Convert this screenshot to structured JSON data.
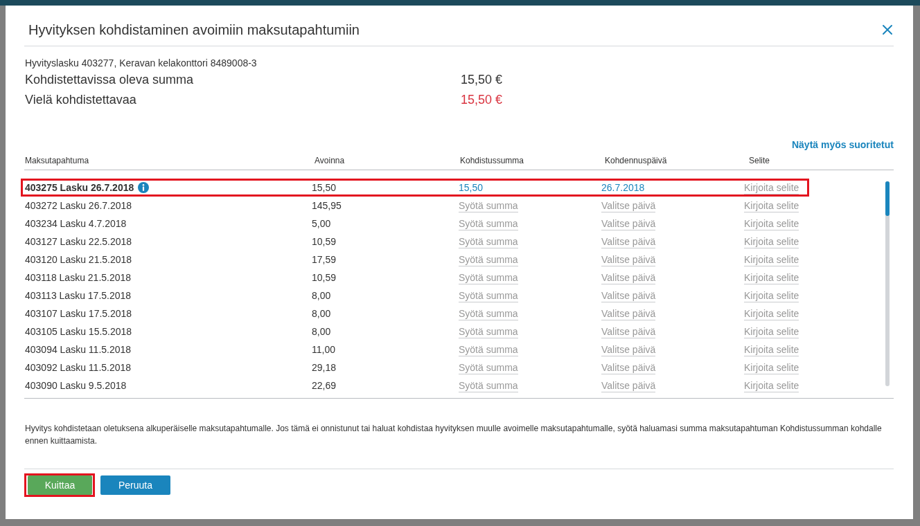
{
  "window": {
    "title": "Hyvityksen kohdistaminen avoimiin maksutapahtumiin"
  },
  "invoice": "Hyvityslasku 403277, Keravan kelakonttori 8489008-3",
  "summary": [
    {
      "label": "Kohdistettavissa oleva summa",
      "value": "15,50 €",
      "kind": "total"
    },
    {
      "label": "Vielä kohdistettavaa",
      "value": "15,50 €",
      "kind": "remaining"
    }
  ],
  "show_completed_link": "Näytä myös suoritetut",
  "table": {
    "columns": [
      "Maksutapahtuma",
      "Avoinna",
      "Kohdistussumma",
      "Kohdennuspäivä",
      "Selite"
    ],
    "rows": [
      {
        "transaction": "403275 Lasku 26.7.2018",
        "selected": true,
        "info": true,
        "highlighted": true,
        "open": "15,50",
        "amount": {
          "value": "15,50"
        },
        "date": {
          "value": "26.7.2018"
        },
        "note": {
          "placeholder": "Kirjoita selite"
        }
      },
      {
        "transaction": "403272 Lasku 26.7.2018",
        "selected": false,
        "info": false,
        "highlighted": false,
        "open": "145,95",
        "amount": {
          "placeholder": "Syötä summa"
        },
        "date": {
          "placeholder": "Valitse päivä"
        },
        "note": {
          "placeholder": "Kirjoita selite"
        }
      },
      {
        "transaction": "403234 Lasku 4.7.2018",
        "selected": false,
        "info": false,
        "highlighted": false,
        "open": "5,00",
        "amount": {
          "placeholder": "Syötä summa"
        },
        "date": {
          "placeholder": "Valitse päivä"
        },
        "note": {
          "placeholder": "Kirjoita selite"
        }
      },
      {
        "transaction": "403127 Lasku 22.5.2018",
        "selected": false,
        "info": false,
        "highlighted": false,
        "open": "10,59",
        "amount": {
          "placeholder": "Syötä summa"
        },
        "date": {
          "placeholder": "Valitse päivä"
        },
        "note": {
          "placeholder": "Kirjoita selite"
        }
      },
      {
        "transaction": "403120 Lasku 21.5.2018",
        "selected": false,
        "info": false,
        "highlighted": false,
        "open": "17,59",
        "amount": {
          "placeholder": "Syötä summa"
        },
        "date": {
          "placeholder": "Valitse päivä"
        },
        "note": {
          "placeholder": "Kirjoita selite"
        }
      },
      {
        "transaction": "403118 Lasku 21.5.2018",
        "selected": false,
        "info": false,
        "highlighted": false,
        "open": "10,59",
        "amount": {
          "placeholder": "Syötä summa"
        },
        "date": {
          "placeholder": "Valitse päivä"
        },
        "note": {
          "placeholder": "Kirjoita selite"
        }
      },
      {
        "transaction": "403113 Lasku 17.5.2018",
        "selected": false,
        "info": false,
        "highlighted": false,
        "open": "8,00",
        "amount": {
          "placeholder": "Syötä summa"
        },
        "date": {
          "placeholder": "Valitse päivä"
        },
        "note": {
          "placeholder": "Kirjoita selite"
        }
      },
      {
        "transaction": "403107 Lasku 17.5.2018",
        "selected": false,
        "info": false,
        "highlighted": false,
        "open": "8,00",
        "amount": {
          "placeholder": "Syötä summa"
        },
        "date": {
          "placeholder": "Valitse päivä"
        },
        "note": {
          "placeholder": "Kirjoita selite"
        }
      },
      {
        "transaction": "403105 Lasku 15.5.2018",
        "selected": false,
        "info": false,
        "highlighted": false,
        "open": "8,00",
        "amount": {
          "placeholder": "Syötä summa"
        },
        "date": {
          "placeholder": "Valitse päivä"
        },
        "note": {
          "placeholder": "Kirjoita selite"
        }
      },
      {
        "transaction": "403094 Lasku 11.5.2018",
        "selected": false,
        "info": false,
        "highlighted": false,
        "open": "11,00",
        "amount": {
          "placeholder": "Syötä summa"
        },
        "date": {
          "placeholder": "Valitse päivä"
        },
        "note": {
          "placeholder": "Kirjoita selite"
        }
      },
      {
        "transaction": "403092 Lasku 11.5.2018",
        "selected": false,
        "info": false,
        "highlighted": false,
        "open": "29,18",
        "amount": {
          "placeholder": "Syötä summa"
        },
        "date": {
          "placeholder": "Valitse päivä"
        },
        "note": {
          "placeholder": "Kirjoita selite"
        }
      },
      {
        "transaction": "403090 Lasku 9.5.2018",
        "selected": false,
        "info": false,
        "highlighted": false,
        "open": "22,69",
        "amount": {
          "placeholder": "Syötä summa"
        },
        "date": {
          "placeholder": "Valitse päivä"
        },
        "note": {
          "placeholder": "Kirjoita selite"
        }
      }
    ]
  },
  "note": "Hyvitys kohdistetaan oletuksena alkuperäiselle maksutapahtumalle. Jos tämä ei onnistunut tai haluat kohdistaa hyvityksen muulle avoimelle maksutapahtumalle, syötä haluamasi summa maksutapahtuman Kohdistussumman kohdalle ennen kuittaamista.",
  "buttons": [
    {
      "label": "Kuittaa",
      "kind": "confirm",
      "highlighted": true
    },
    {
      "label": "Peruuta",
      "kind": "cancel",
      "highlighted": false
    }
  ]
}
